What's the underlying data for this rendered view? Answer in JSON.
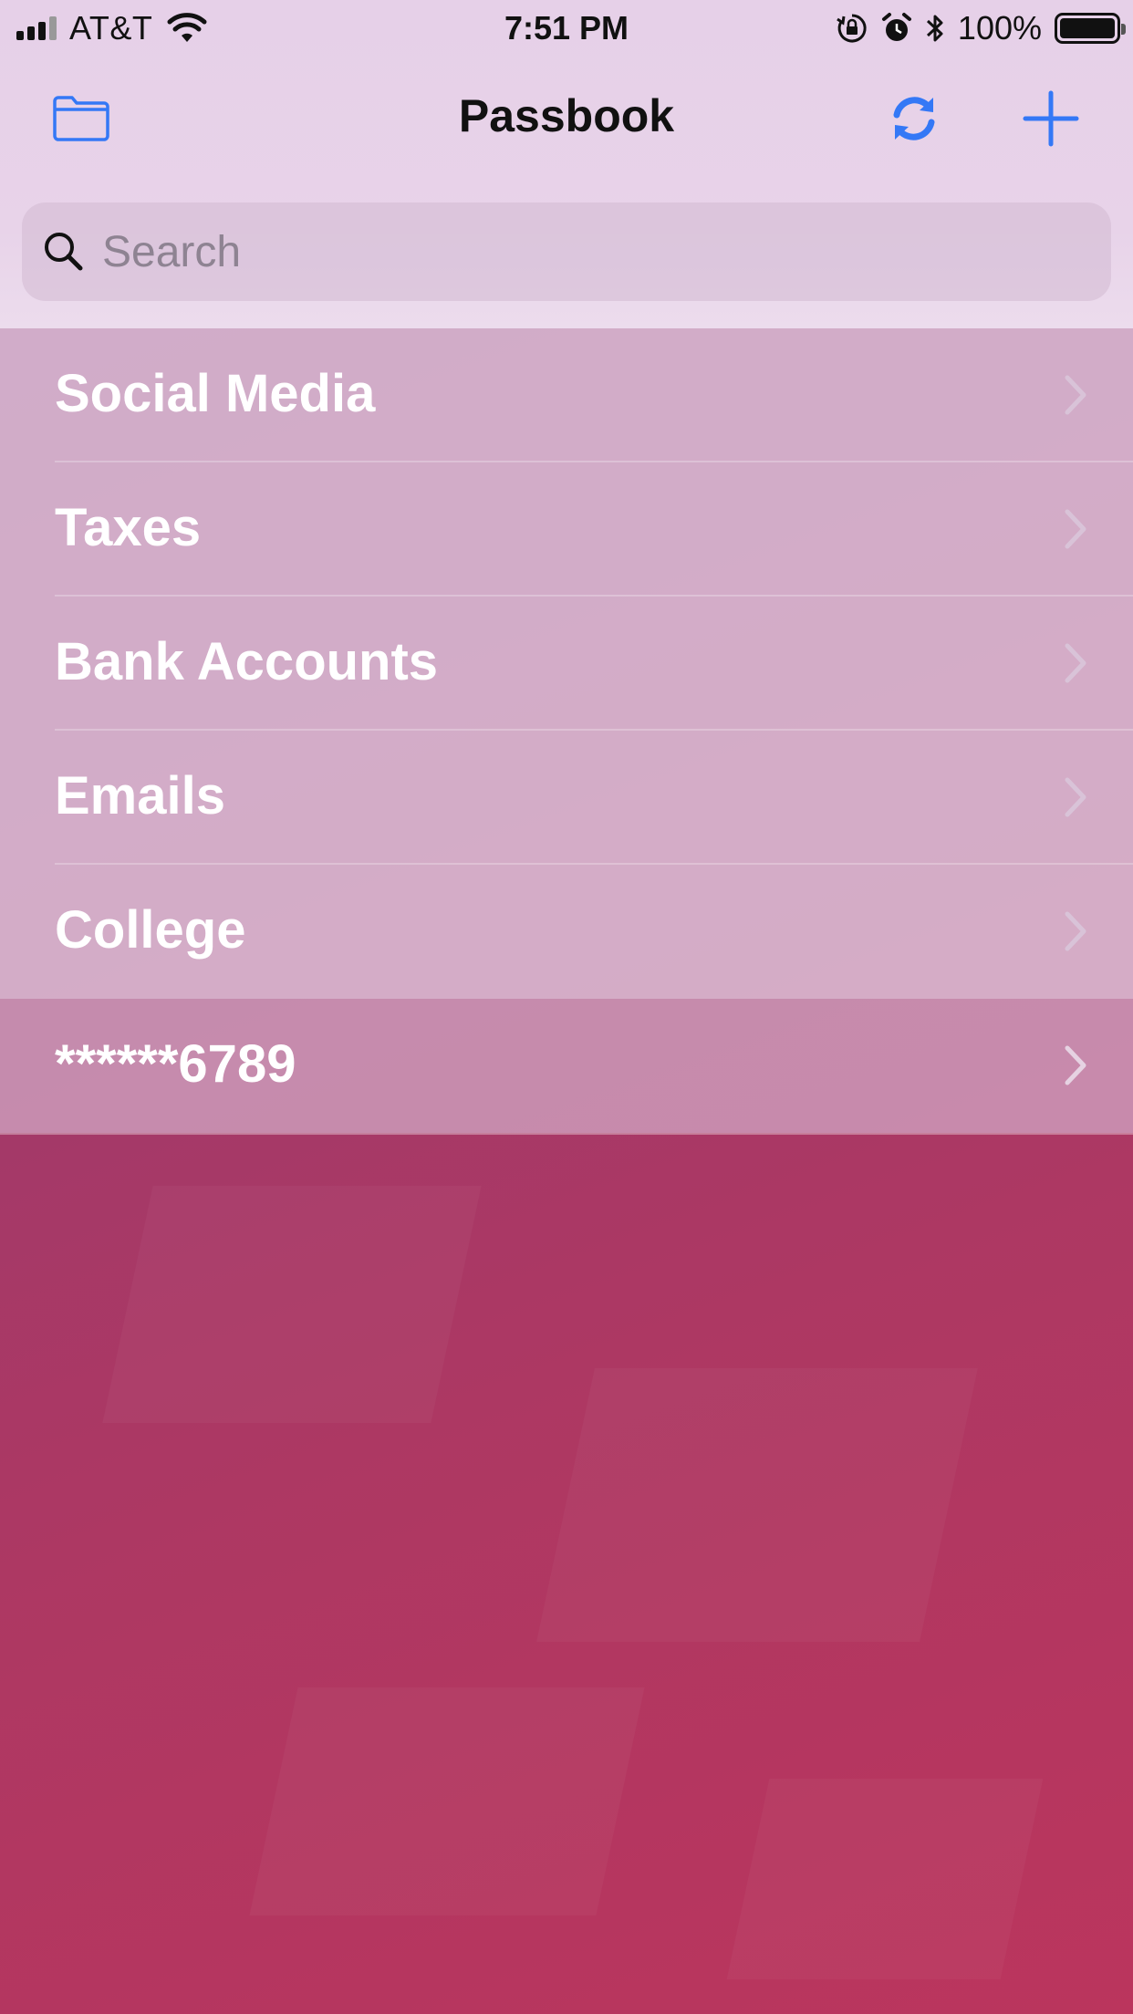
{
  "status_bar": {
    "carrier": "AT&T",
    "time": "7:51 PM",
    "battery": "100%"
  },
  "nav": {
    "title": "Passbook",
    "folder_icon": "folder-icon",
    "sync_icon": "sync-icon",
    "add_icon": "plus-icon"
  },
  "search": {
    "placeholder": "Search",
    "value": ""
  },
  "list": {
    "items": [
      {
        "label": "Social Media"
      },
      {
        "label": "Taxes"
      },
      {
        "label": "Bank Accounts"
      },
      {
        "label": "Emails"
      },
      {
        "label": "College"
      },
      {
        "label": "******6789"
      }
    ]
  },
  "colors": {
    "accent": "#3478f6",
    "background_bottom": "#bb355d",
    "background_top": "#8f3a75"
  }
}
